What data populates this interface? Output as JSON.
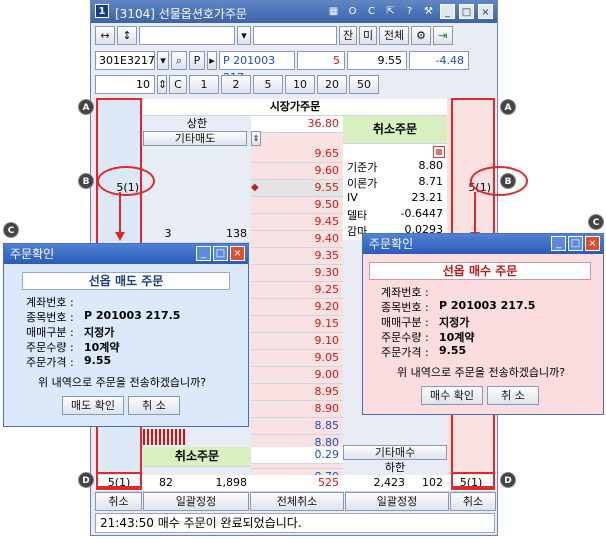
{
  "window": {
    "title": "[3104] 선물옵션호가주문",
    "icon_no": "1",
    "title_icons": [
      "grid-icon",
      "o-icon",
      "c-icon",
      "link-icon",
      "help-icon",
      "wrench-icon"
    ],
    "win_buttons": [
      "minimize-icon",
      "restore-icon",
      "close-icon"
    ]
  },
  "toolbar": {
    "arrows_lr": "↔",
    "arrows_ud": "↕",
    "jan_label": "잔",
    "mi_label": "미",
    "all_label": "전체"
  },
  "account_row": {
    "account": "301E3217",
    "p_label": "P",
    "code": "P 201003 217",
    "qty": "5",
    "price": "9.55",
    "change": "-4.48"
  },
  "qty_row": {
    "value": "10",
    "c_label": "C",
    "presets": [
      "1",
      "2",
      "5",
      "10",
      "20",
      "50"
    ]
  },
  "book": {
    "header": "시장가주문",
    "upper_label": "상한",
    "upper_value": "36.80",
    "other_sell": "기타매도",
    "cancel_order": "취소주문",
    "other_buy": "기타매수",
    "lower_label": "하한",
    "asks": [
      "9.65",
      "9.60",
      "9.55",
      "9.50",
      "9.45",
      "9.40",
      "9.35",
      "9.30",
      "9.25",
      "9.20",
      "9.15"
    ],
    "bids": [
      "9.10",
      "9.05",
      "9.00",
      "8.95",
      "8.90",
      "8.85",
      "8.80",
      "8.75",
      "8.70",
      "8.65"
    ],
    "ask_qty_row": {
      "count": "3",
      "qty": "138",
      "price": "9.40"
    },
    "ask_qty_row2": {
      "qty": "0"
    },
    "my_sell": "5(1)",
    "my_buy": "5(1)",
    "info": [
      {
        "k": "기준가",
        "v": "8.80"
      },
      {
        "k": "이론가",
        "v": "8.71"
      },
      {
        "k": "IV",
        "v": "23.21"
      },
      {
        "k": "델타",
        "v": "-0.6447"
      },
      {
        "k": "감마",
        "v": "0.0293"
      }
    ],
    "bottom_change": "0.29",
    "sum_sell_count": "82",
    "sum_sell_qty": "1,898",
    "sum_diff": "525",
    "sum_buy_qty": "2,423",
    "sum_buy_count": "102",
    "footer_sell_pending": "5(1)",
    "footer_buy_pending": "5(1)",
    "btn_cancel": "취소",
    "btn_bulk_fix": "일괄정정",
    "btn_all_cancel": "전체취소"
  },
  "status_text": "21:43:50 매수 주문이 완료되었습니다.",
  "markers": [
    "A",
    "A",
    "B",
    "B",
    "C",
    "C",
    "D",
    "D"
  ],
  "dialog_sell": {
    "title": "주문확인",
    "heading": "선옵 매도 주문",
    "rows": [
      {
        "k": "계좌번호 :",
        "v": ""
      },
      {
        "k": "종목번호 :",
        "v": "P 201003 217.5"
      },
      {
        "k": "매매구분 :",
        "v": "지정가"
      },
      {
        "k": "주문수량 :",
        "v": "10계약"
      },
      {
        "k": "주문가격 :",
        "v": "9.55"
      }
    ],
    "question": "위 내역으로 주문을 전송하겠습니까?",
    "ok": "매도 확인",
    "cancel": "취 소"
  },
  "dialog_buy": {
    "title": "주문확인",
    "heading": "선옵 매수 주문",
    "rows": [
      {
        "k": "계좌번호 :",
        "v": ""
      },
      {
        "k": "종목번호 :",
        "v": "P 201003 217.5"
      },
      {
        "k": "매매구분 :",
        "v": "지정가"
      },
      {
        "k": "주문수량 :",
        "v": "10계약"
      },
      {
        "k": "주문가격 :",
        "v": "9.55"
      }
    ],
    "question": "위 내역으로 주문을 전송하겠습니까?",
    "ok": "매수 확인",
    "cancel": "취 소"
  },
  "colors": {
    "ask": "#d01a1a",
    "bid": "#1b4fc8",
    "highlight": "#e02a2a",
    "cancel_bg": "#d8efc0",
    "sell_dialog_bg": "#dce9fb",
    "buy_dialog_bg": "#fbdde0"
  }
}
